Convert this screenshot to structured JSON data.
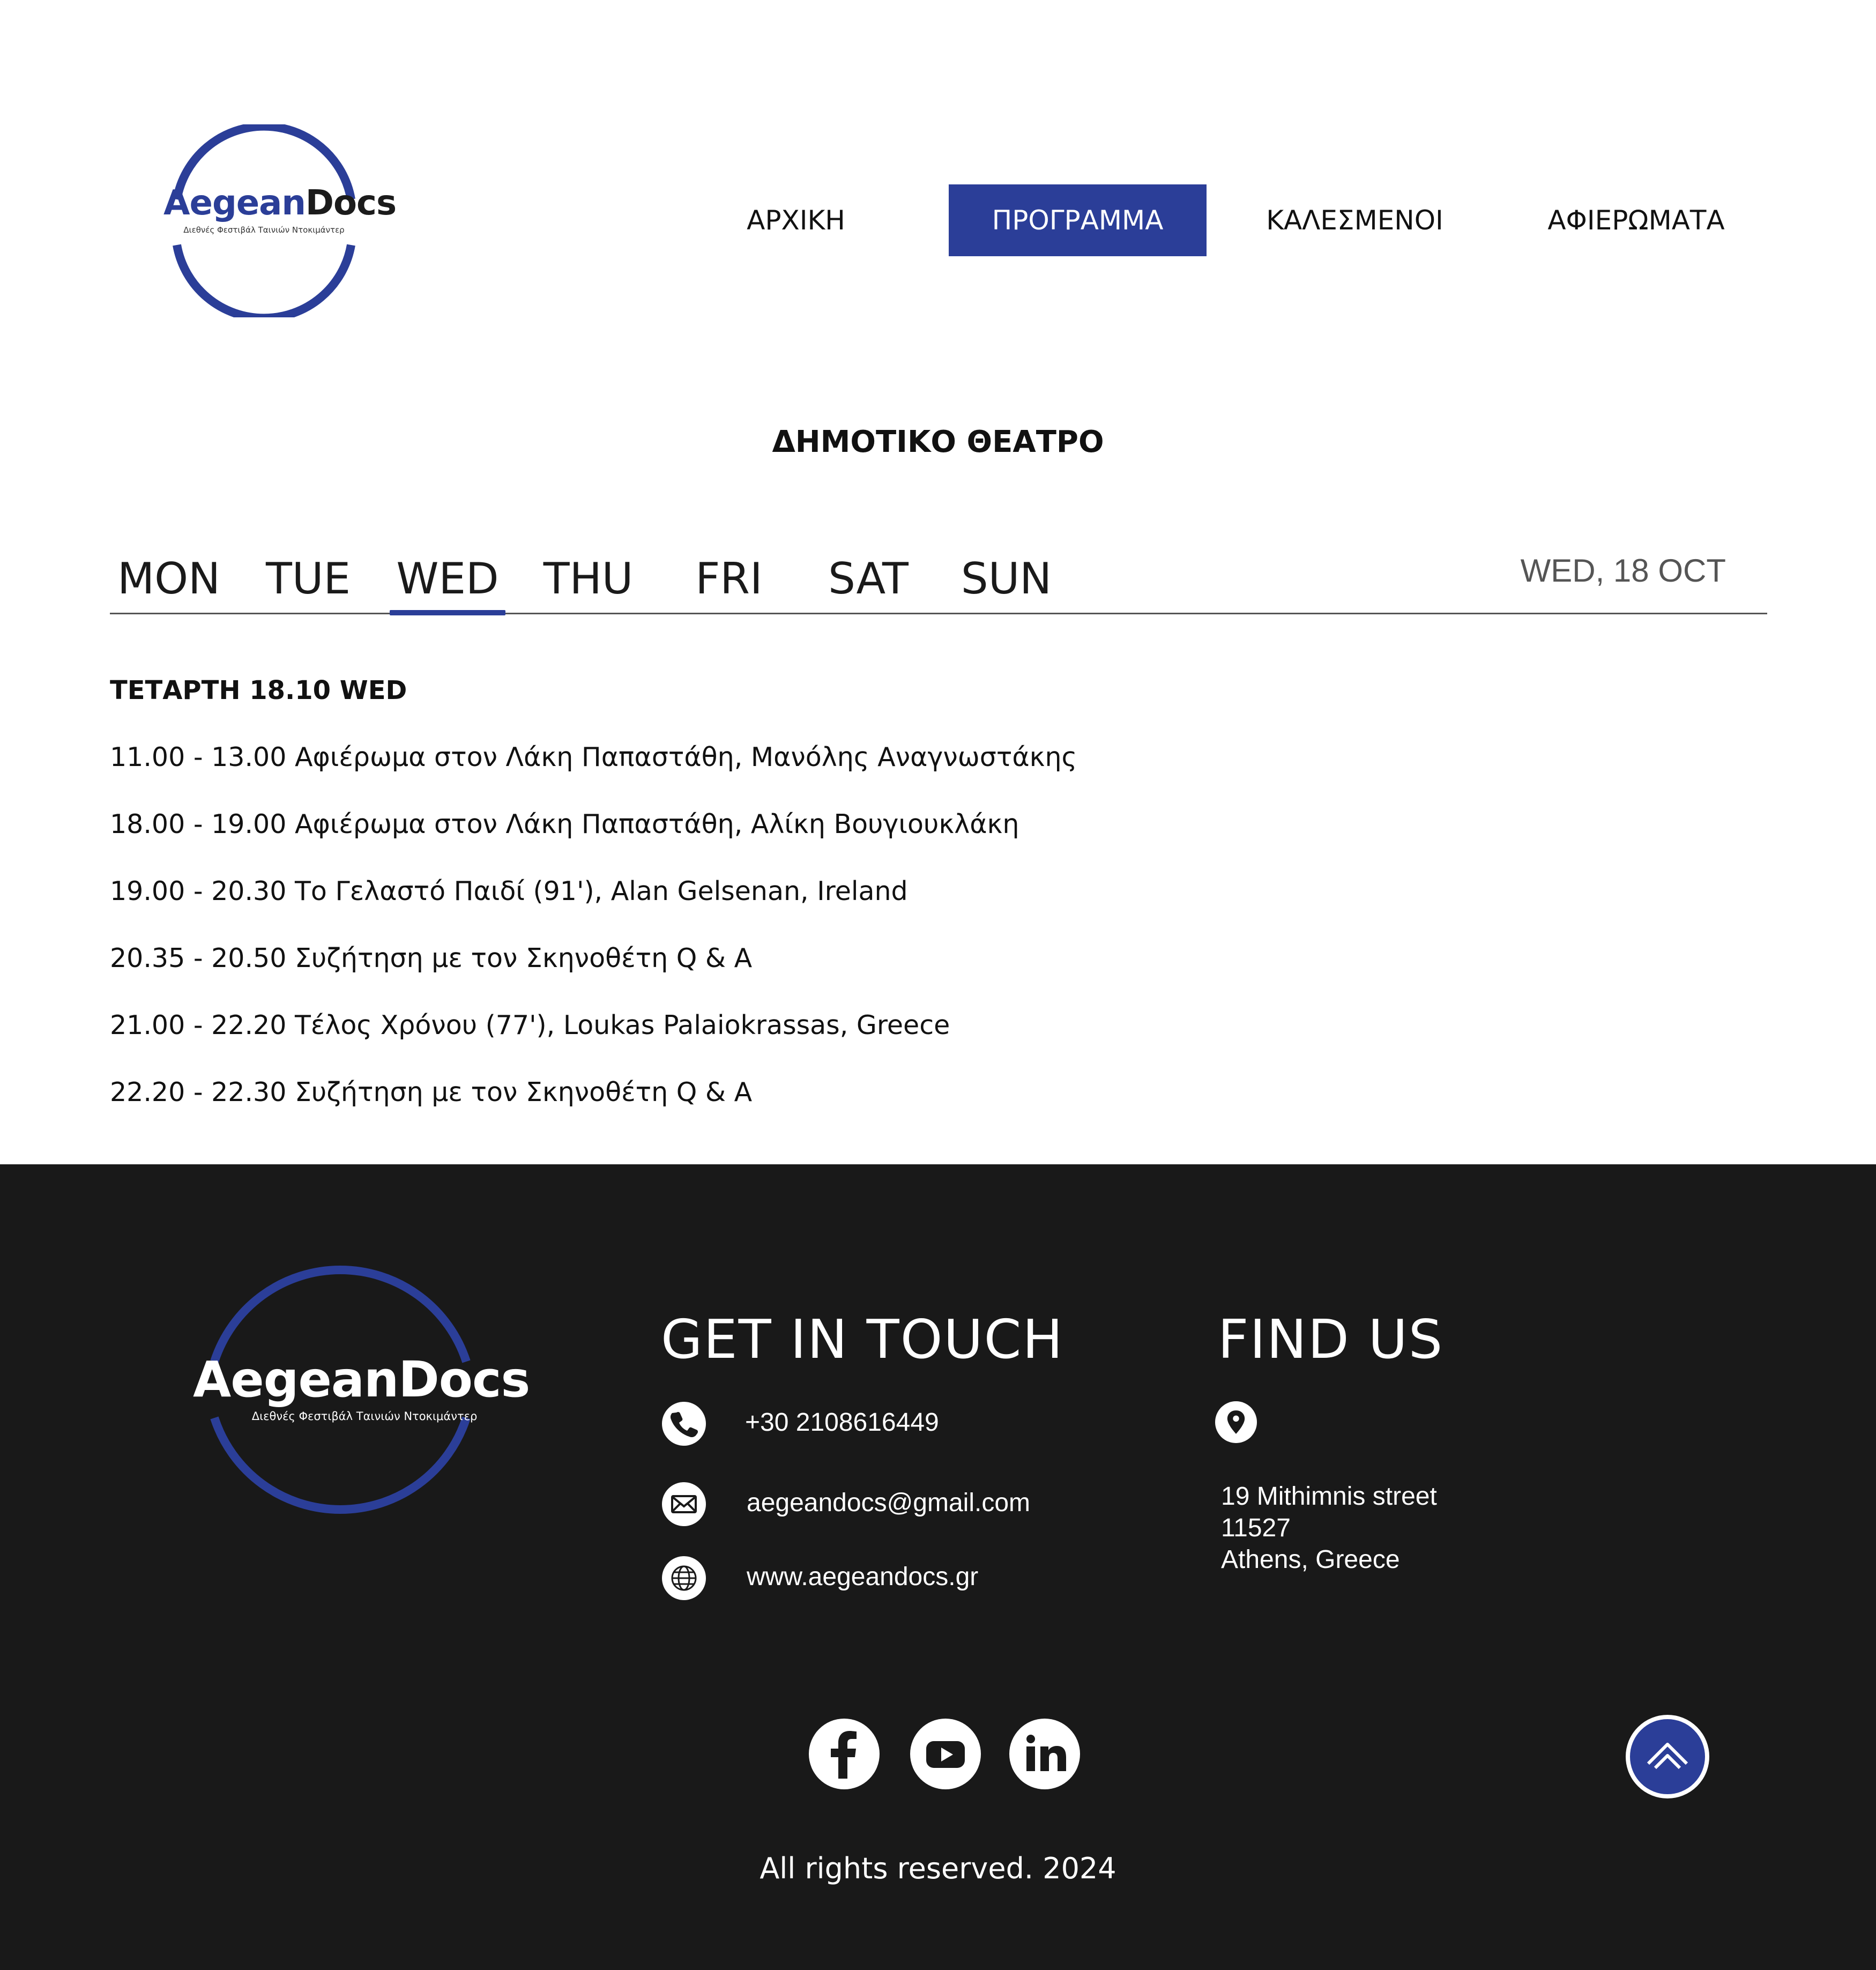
{
  "brand": {
    "name_part1": "Aegean",
    "name_part2": "Docs",
    "name": "AegeanDocs",
    "tagline": "Διεθνές Φεστιβάλ Ταινιών Ντοκιμάντερ",
    "accent_color": "#2b3e98",
    "footer_bg": "#191919"
  },
  "nav": {
    "items": [
      {
        "label": "ΑΡΧΙΚΗ",
        "active": false
      },
      {
        "label": "ΠΡΟΓΡΑΜΜΑ",
        "active": true
      },
      {
        "label": "ΚΑΛΕΣΜΕΝΟΙ",
        "active": false
      },
      {
        "label": "ΑΦΙΕΡΩΜΑΤΑ",
        "active": false
      }
    ]
  },
  "venue": "ΔΗΜΟΤΙΚΟ ΘΕΑΤΡΟ",
  "days": {
    "tabs": [
      "MON",
      "TUE",
      "WED",
      "THU",
      "FRI",
      "SAT",
      "SUN"
    ],
    "selected": "WED",
    "current_date": "WED, 18 OCT"
  },
  "schedule": {
    "heading": "ΤΕΤΑΡΤΗ 18.10 WED",
    "items": [
      "11.00 - 13.00 Αφιέρωμα στον Λάκη Παπαστάθη, Μανόλης Αναγνωστάκης",
      "18.00 - 19.00 Αφιέρωμα στον Λάκη Παπαστάθη, Αλίκη Βουγιουκλάκη",
      "19.00 - 20.30 Το Γελαστό Παιδί (91'), Alan Gelsenan, Ireland",
      "20.35 - 20.50 Συζήτηση με τον Σκηνοθέτη Q & A",
      "21.00 - 22.20 Τέλος Χρόνου (77'), Loukas Palaiokrassas, Greece",
      "22.20 - 22.30 Συζήτηση με τον Σκηνοθέτη Q & A"
    ]
  },
  "footer": {
    "get_in_touch": {
      "title": "GET IN TOUCH",
      "phone": "+30 2108616449",
      "email": "aegeandocs@gmail.com",
      "website": "www.aegeandocs.gr"
    },
    "find_us": {
      "title": "FIND US",
      "address_line1": "19 Mithimnis street",
      "address_line2": "11527",
      "address_line3": "Athens, Greece"
    },
    "social": [
      "facebook-icon",
      "youtube-icon",
      "linkedin-icon"
    ],
    "copyright": "All rights reserved. 2024"
  }
}
